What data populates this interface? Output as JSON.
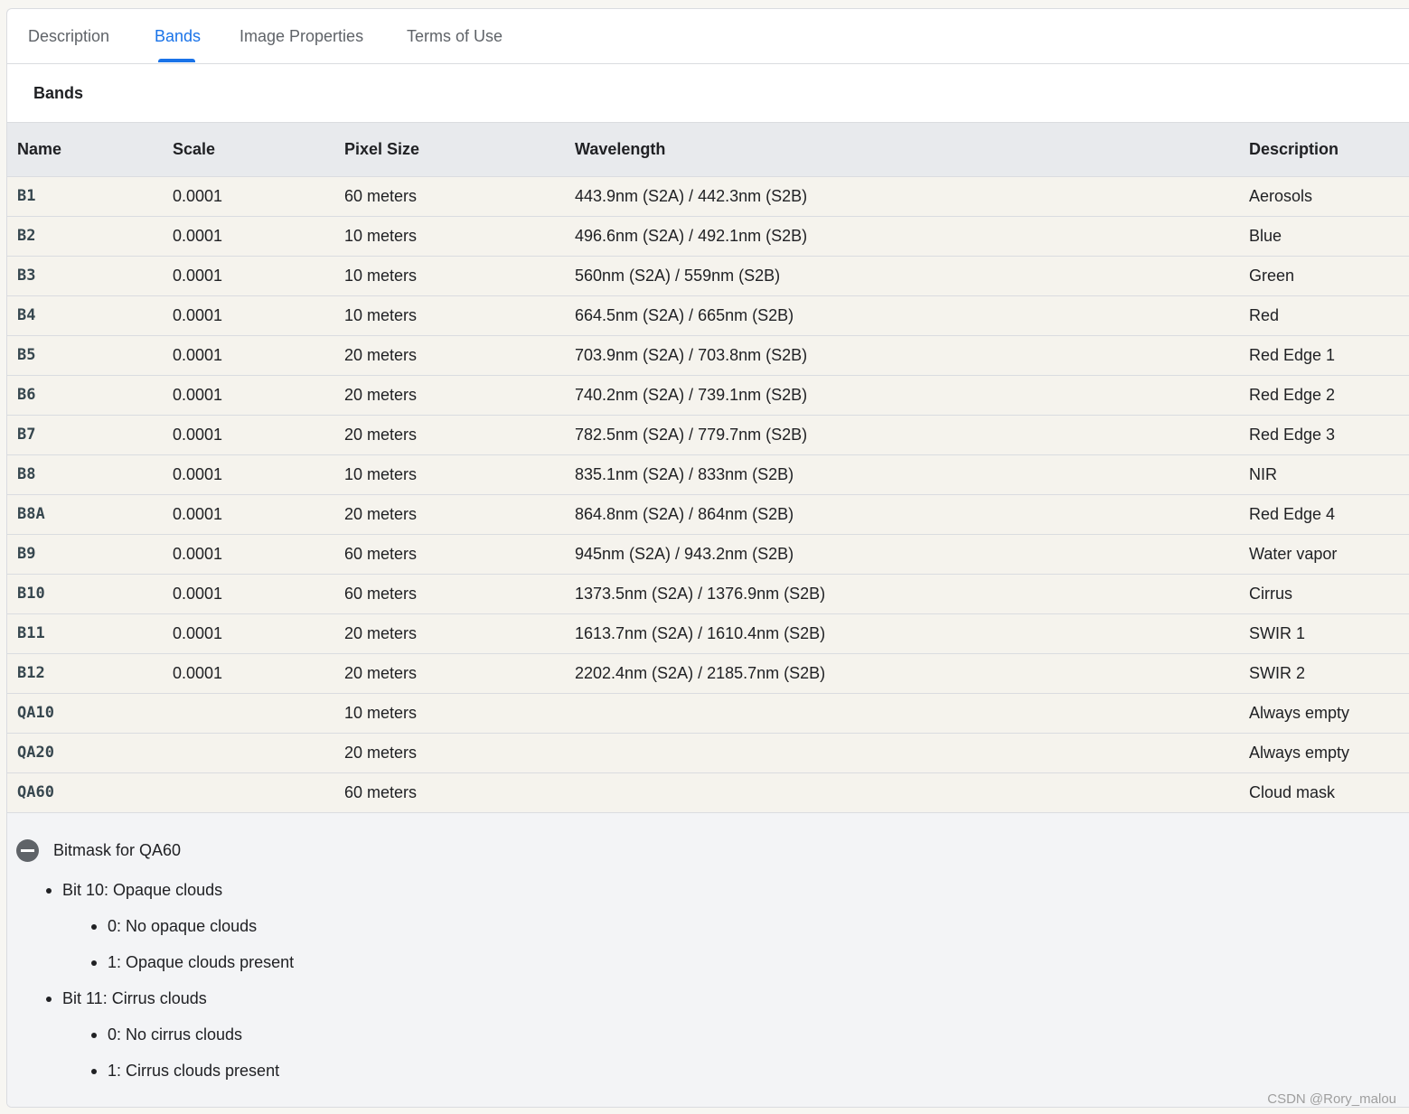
{
  "tabs": [
    {
      "label": "Description"
    },
    {
      "label": "Bands"
    },
    {
      "label": "Image Properties"
    },
    {
      "label": "Terms of Use"
    }
  ],
  "active_tab": "Bands",
  "section_title": "Bands",
  "table": {
    "headers": [
      "Name",
      "Scale",
      "Pixel Size",
      "Wavelength",
      "Description"
    ],
    "rows": [
      {
        "name": "B1",
        "scale": "0.0001",
        "pixel_size": "60 meters",
        "wavelength": "443.9nm (S2A) / 442.3nm (S2B)",
        "description": "Aerosols"
      },
      {
        "name": "B2",
        "scale": "0.0001",
        "pixel_size": "10 meters",
        "wavelength": "496.6nm (S2A) / 492.1nm (S2B)",
        "description": "Blue"
      },
      {
        "name": "B3",
        "scale": "0.0001",
        "pixel_size": "10 meters",
        "wavelength": "560nm (S2A) / 559nm (S2B)",
        "description": "Green"
      },
      {
        "name": "B4",
        "scale": "0.0001",
        "pixel_size": "10 meters",
        "wavelength": "664.5nm (S2A) / 665nm (S2B)",
        "description": "Red"
      },
      {
        "name": "B5",
        "scale": "0.0001",
        "pixel_size": "20 meters",
        "wavelength": "703.9nm (S2A) / 703.8nm (S2B)",
        "description": "Red Edge 1"
      },
      {
        "name": "B6",
        "scale": "0.0001",
        "pixel_size": "20 meters",
        "wavelength": "740.2nm (S2A) / 739.1nm (S2B)",
        "description": "Red Edge 2"
      },
      {
        "name": "B7",
        "scale": "0.0001",
        "pixel_size": "20 meters",
        "wavelength": "782.5nm (S2A) / 779.7nm (S2B)",
        "description": "Red Edge 3"
      },
      {
        "name": "B8",
        "scale": "0.0001",
        "pixel_size": "10 meters",
        "wavelength": "835.1nm (S2A) / 833nm (S2B)",
        "description": "NIR"
      },
      {
        "name": "B8A",
        "scale": "0.0001",
        "pixel_size": "20 meters",
        "wavelength": "864.8nm (S2A) / 864nm (S2B)",
        "description": "Red Edge 4"
      },
      {
        "name": "B9",
        "scale": "0.0001",
        "pixel_size": "60 meters",
        "wavelength": "945nm (S2A) / 943.2nm (S2B)",
        "description": "Water vapor"
      },
      {
        "name": "B10",
        "scale": "0.0001",
        "pixel_size": "60 meters",
        "wavelength": "1373.5nm (S2A) / 1376.9nm (S2B)",
        "description": "Cirrus"
      },
      {
        "name": "B11",
        "scale": "0.0001",
        "pixel_size": "20 meters",
        "wavelength": "1613.7nm (S2A) / 1610.4nm (S2B)",
        "description": "SWIR 1"
      },
      {
        "name": "B12",
        "scale": "0.0001",
        "pixel_size": "20 meters",
        "wavelength": "2202.4nm (S2A) / 2185.7nm (S2B)",
        "description": "SWIR 2"
      },
      {
        "name": "QA10",
        "scale": "",
        "pixel_size": "10 meters",
        "wavelength": "",
        "description": "Always empty"
      },
      {
        "name": "QA20",
        "scale": "",
        "pixel_size": "20 meters",
        "wavelength": "",
        "description": "Always empty"
      },
      {
        "name": "QA60",
        "scale": "",
        "pixel_size": "60 meters",
        "wavelength": "",
        "description": "Cloud mask"
      }
    ]
  },
  "bitmask": {
    "title": "Bitmask for QA60",
    "icon": "minus-circle-icon",
    "bits": [
      {
        "label": "Bit 10: Opaque clouds",
        "values": [
          "0: No opaque clouds",
          "1: Opaque clouds present"
        ]
      },
      {
        "label": "Bit 11: Cirrus clouds",
        "values": [
          "0: No cirrus clouds",
          "1: Cirrus clouds present"
        ]
      }
    ]
  },
  "watermark": "CSDN @Rory_malou",
  "colors": {
    "accent": "#1a73e8",
    "header_bg": "#e8eaed",
    "row_bg": "#f5f3ed"
  }
}
